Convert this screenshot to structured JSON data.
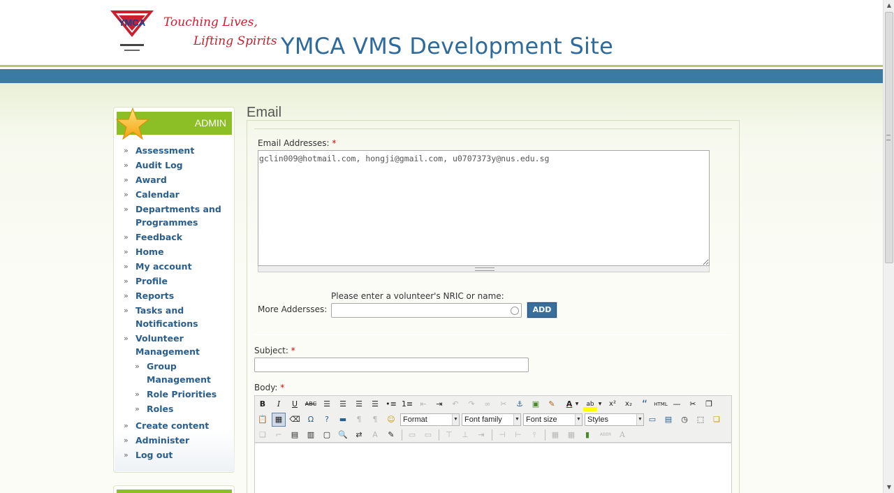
{
  "header": {
    "logo_text": "YMCA",
    "slogan_line1": "Touching Lives,",
    "slogan_line2": "Lifting Spirits",
    "site_name": "YMCA VMS Development Site"
  },
  "sidebar": {
    "title": "ADMIN",
    "items": [
      {
        "label": "Assessment"
      },
      {
        "label": "Audit Log"
      },
      {
        "label": "Award"
      },
      {
        "label": "Calendar"
      },
      {
        "label": "Departments and Programmes"
      },
      {
        "label": "Feedback"
      },
      {
        "label": "Home"
      },
      {
        "label": "My account"
      },
      {
        "label": "Profile"
      },
      {
        "label": "Reports"
      },
      {
        "label": "Tasks and Notifications"
      },
      {
        "label": "Volunteer Management"
      },
      {
        "label": "Group Management"
      },
      {
        "label": "Role Priorities"
      },
      {
        "label": "Roles"
      },
      {
        "label": "Create content"
      },
      {
        "label": "Administer"
      },
      {
        "label": "Log out"
      }
    ]
  },
  "main": {
    "title": "Email",
    "email_label": "Email Addresses:",
    "required_mark": "*",
    "email_value": "gclin009@hotmail.com, hongji@gmail.com, u0707373y@nus.edu.sg",
    "more_hint": "Please enter a volunteer's NRIC or name:",
    "more_label": "More Addersses:",
    "add_button": "ADD",
    "subject_label": "Subject:",
    "body_label": "Body:"
  },
  "editor": {
    "format": "Format",
    "font_family": "Font family",
    "font_size": "Font size",
    "styles": "Styles",
    "bold": "B",
    "italic": "I",
    "underline": "U",
    "strike": "ABC",
    "omega": "Ω",
    "superscript": "x²",
    "subscript": "x₂",
    "html": "HTML",
    "abbr": "ABBR",
    "blockquote": "“",
    "font_color": "A",
    "highlight": "ab",
    "dropdown_glyph": "▼"
  }
}
